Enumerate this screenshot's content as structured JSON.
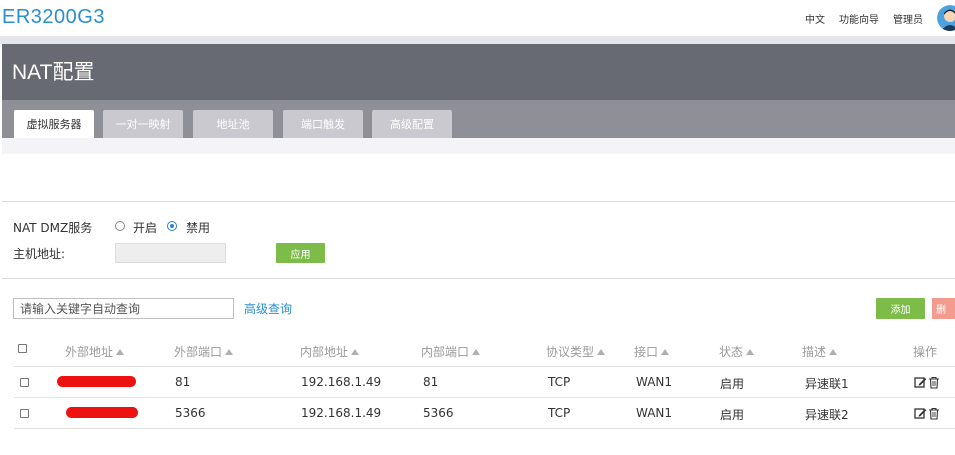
{
  "app": {
    "brand": "ER3200G3"
  },
  "topbar": {
    "language": "中文",
    "wizard": "功能向导",
    "admin": "管理员"
  },
  "page": {
    "title": "NAT配置"
  },
  "tabs": [
    {
      "label": "虚拟服务器",
      "active": true
    },
    {
      "label": "一对一映射",
      "active": false
    },
    {
      "label": "地址池",
      "active": false
    },
    {
      "label": "端口触发",
      "active": false
    },
    {
      "label": "高级配置",
      "active": false
    }
  ],
  "dmz": {
    "label": "NAT DMZ服务",
    "on_label": "开启",
    "off_label": "禁用",
    "selected": "off",
    "host_label": "主机地址:",
    "host_value": "",
    "apply_label": "应用"
  },
  "search": {
    "placeholder": "请输入关键字自动查询",
    "advanced_label": "高级查询",
    "add_label": "添加",
    "delete_label": "删"
  },
  "table": {
    "columns": [
      "外部地址",
      "外部端口",
      "内部地址",
      "内部端口",
      "协议类型",
      "接口",
      "状态",
      "描述",
      "操作"
    ],
    "rows": [
      {
        "external_address": "",
        "external_port": "81",
        "internal_address": "192.168.1.49",
        "internal_port": "81",
        "protocol": "TCP",
        "interface": "WAN1",
        "status": "启用",
        "description": "异速联1"
      },
      {
        "external_address": "",
        "external_port": "5366",
        "internal_address": "192.168.1.49",
        "internal_port": "5366",
        "protocol": "TCP",
        "interface": "WAN1",
        "status": "启用",
        "description": "异速联2"
      }
    ]
  },
  "colors": {
    "brand": "#2a8fd0",
    "header": "#686a73",
    "tabs_band": "#8f8f97",
    "green_button": "#7ebc4a",
    "red_button": "#f29b8e",
    "redaction": "#ee1111"
  }
}
